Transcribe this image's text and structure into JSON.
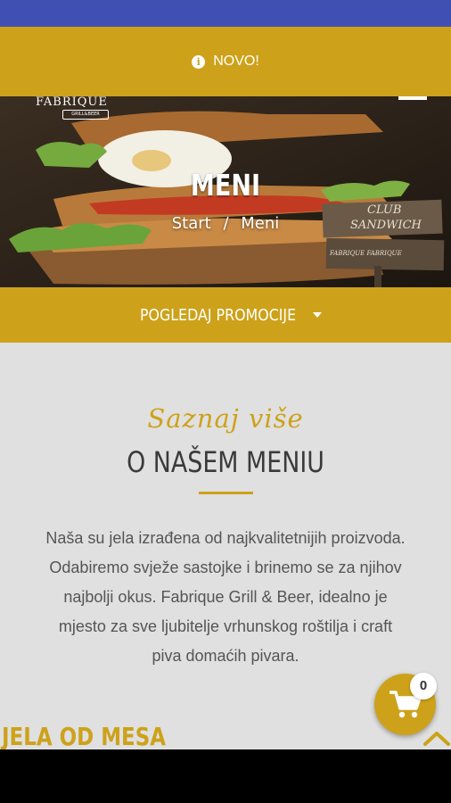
{
  "notice": {
    "icon": "info-icon",
    "text": "NOVO!"
  },
  "hero": {
    "logo_text": "FABRIQUE",
    "logo_sub": "GRILL&BEER",
    "title": "MENI",
    "breadcrumb": {
      "home": "Start",
      "separator": "/",
      "current": "Meni"
    },
    "sign_text_1": "CLUB",
    "sign_text_2": "SANDWICH",
    "sign_text_3": "FABRIQUE FABRIQUE"
  },
  "promo": {
    "label": "POGLEDAJ PROMOCIJE"
  },
  "about": {
    "script_title": "Saznaj više",
    "heading": "O NAŠEM MENIU",
    "lines": [
      "Naša su jela izrađena od najkvalitetnijih proizvoda.",
      "Odabiremo svježe sastojke i brinemo se za njihov",
      "najbolji okus. Fabrique Grill & Beer, idealno je",
      "mjesto za sve ljubitelje vrhunskog roštilja i craft",
      "piva domaćih pivara."
    ]
  },
  "section_title": "JELA OD MESA",
  "cart": {
    "count": "0"
  },
  "colors": {
    "accent": "#cda21a",
    "statusbar": "#3f4fb2",
    "background": "#e0e0e0"
  }
}
